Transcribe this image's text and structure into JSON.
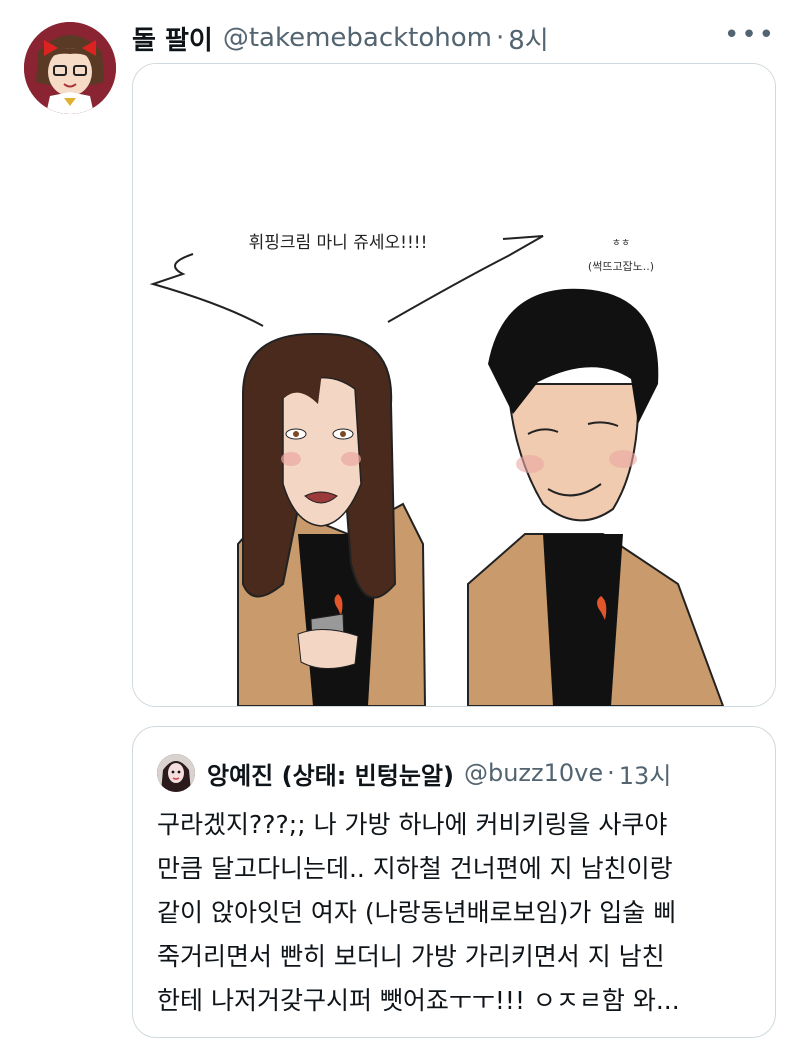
{
  "tweet": {
    "display_name": "돌 팔이",
    "handle": "@takemebacktohom",
    "dot": "·",
    "time": "8시",
    "more_icon": "more-icon"
  },
  "comic": {
    "speech_left": "휘핑크림 마니 쥬세오!!!!",
    "speech_right_top": "ㅎㅎ",
    "speech_right_sub": "(썩뜨고잡노..)"
  },
  "quote": {
    "display_name": "앙예진 (상태: 빈텅눈알)",
    "handle": "@buzz10ve",
    "dot": "·",
    "time": "13시",
    "lines": [
      "구라겠지???;; 나 가방 하나에 커비키링을 사쿠야",
      "만큼 달고다니는데.. 지하철 건너편에 지 남친이랑",
      "같이 앉아잇던 여자 (나랑동년배로보임)가 입술 삐",
      "죽거리면서 빤히 보더니 가방 가리키면서  지 남친",
      "한테 나저거갖구시퍼 뺏어죠ㅜㅜ!!! ㅇㅈㄹ함 와..."
    ]
  }
}
